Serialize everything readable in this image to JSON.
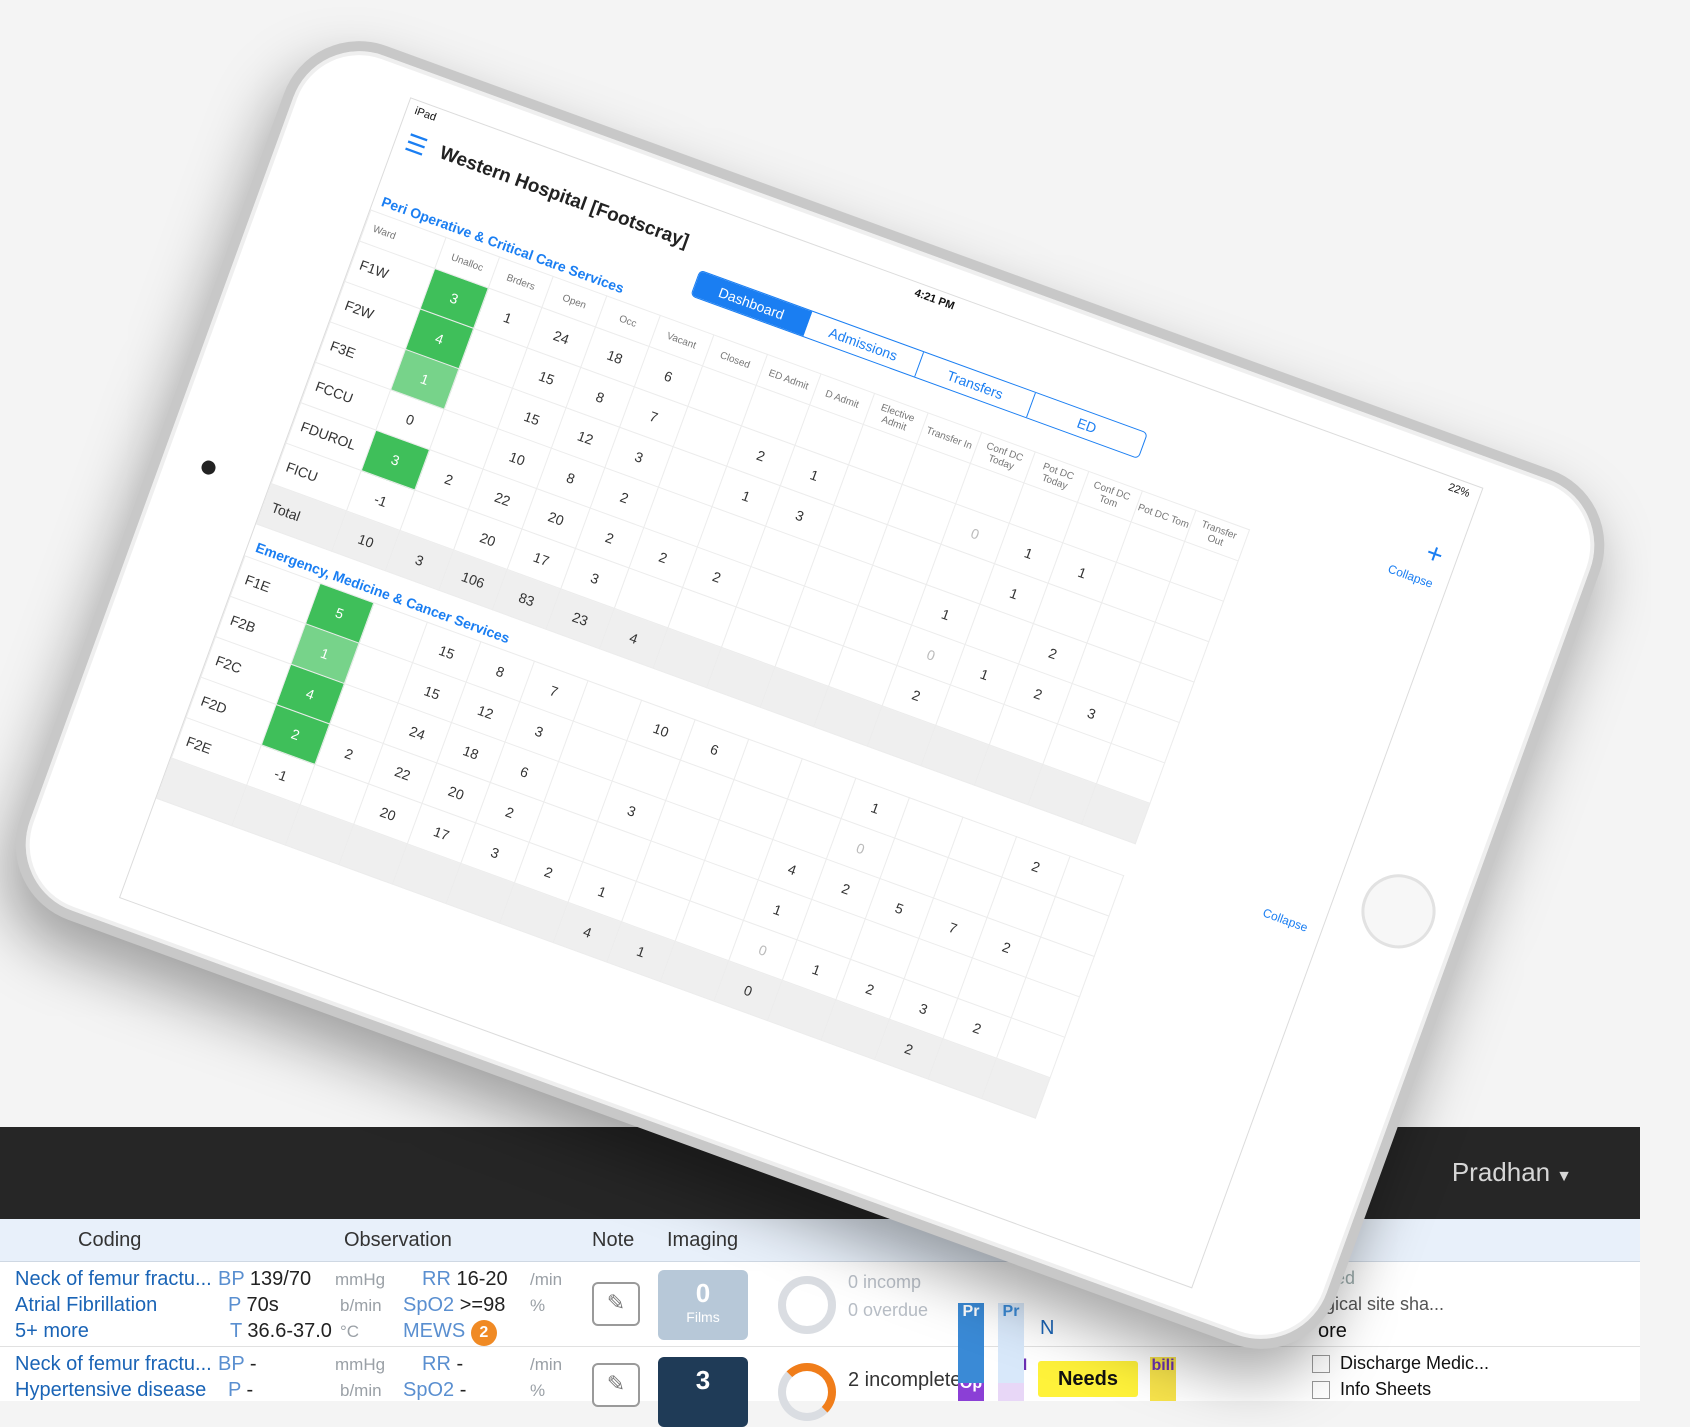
{
  "background_app": {
    "user_name": "Pradhan",
    "headers": [
      "Coding",
      "Observation",
      "Note",
      "Imaging"
    ],
    "rows": [
      {
        "coding": [
          "Neck of femur fractu...",
          "Atrial Fibrillation",
          "5+ more"
        ],
        "obs": {
          "bp_label": "BP",
          "bp": "139/70",
          "bp_unit": "mmHg",
          "p_label": "P",
          "p": "70s",
          "p_unit": "b/min",
          "t_label": "T",
          "t": "36.6-37.0",
          "t_unit": "°C",
          "rr_label": "RR",
          "rr": "16-20",
          "rr_unit": "/min",
          "spo2_label": "SpO2",
          "spo2": ">=98",
          "spo2_unit": "%",
          "mews_label": "MEWS",
          "mews": "2"
        },
        "imaging_count": "0",
        "imaging_label": "Films",
        "tasks": [
          "0 incomp",
          "0 overdue"
        ],
        "right_text": [
          "ed",
          "gical site sha...",
          "ore"
        ]
      },
      {
        "coding": [
          "Neck of femur fractu...",
          "Hypertensive disease"
        ],
        "obs": {
          "bp_label": "BP",
          "bp": "-",
          "bp_unit": "mmHg",
          "p_label": "P",
          "p": "-",
          "p_unit": "b/min",
          "rr_label": "RR",
          "rr": "-",
          "rr_unit": "/min",
          "spo2_label": "SpO2",
          "spo2": "-",
          "spo2_unit": "%"
        },
        "imaging_count": "3",
        "tasks": [
          "2 incomplete"
        ],
        "status_badge": "Needs",
        "checklist": [
          "Discharge Medic...",
          "Info Sheets"
        ]
      }
    ],
    "tags": [
      "Pr",
      "Pr",
      "t-Op",
      "und",
      "N",
      "bili"
    ]
  },
  "ipad": {
    "status_left": "iPad",
    "time": "4:21 PM",
    "battery": "22%",
    "hospital": "Western Hospital [Footscray]",
    "tabs": [
      "Dashboard",
      "Admissions",
      "Transfers",
      "ED"
    ],
    "active_tab": "Dashboard",
    "collapse_label": "Collapse",
    "columns": [
      "Ward",
      "Unalloc",
      "Brders",
      "Open",
      "Occ",
      "Vacant",
      "Closed",
      "ED Admit",
      "D Admit",
      "Elective Admit",
      "Transfer In",
      "Conf DC Today",
      "Pot DC Today",
      "Conf DC Tom",
      "Pot DC Tom",
      "Transfer Out"
    ],
    "sections": [
      {
        "title": "Peri Operative & Critical Care Services",
        "rows": [
          {
            "ward": "F1W",
            "cells": [
              "3",
              "1",
              "24",
              "18",
              "6",
              "",
              "",
              "",
              "",
              "",
              "",
              "",
              "",
              "",
              ""
            ]
          },
          {
            "ward": "F2W",
            "cells": [
              "4",
              "",
              "15",
              "8",
              "7",
              "",
              "2",
              "1",
              "",
              "",
              "0",
              "1",
              "1",
              "",
              ""
            ]
          },
          {
            "ward": "F3E",
            "cells": [
              "1",
              "",
              "15",
              "12",
              "3",
              "",
              "1",
              "3",
              "",
              "",
              "",
              "1",
              "",
              "",
              ""
            ]
          },
          {
            "ward": "FCCU",
            "cells": [
              "0",
              "",
              "10",
              "8",
              "2",
              "",
              "",
              "",
              "",
              "",
              "1",
              "",
              "2",
              "",
              ""
            ]
          },
          {
            "ward": "FDUROL",
            "cells": [
              "3",
              "2",
              "22",
              "20",
              "2",
              "2",
              "2",
              "",
              "",
              "",
              "0",
              "1",
              "2",
              "3",
              ""
            ]
          },
          {
            "ward": "FICU",
            "cells": [
              "-1",
              "",
              "20",
              "17",
              "3",
              "",
              "",
              "",
              "",
              "",
              "2",
              "",
              "",
              "",
              ""
            ]
          }
        ],
        "total": [
          "10",
          "3",
          "106",
          "83",
          "23",
          "4",
          "",
          "",
          "",
          "",
          "",
          "",
          "",
          "",
          ""
        ]
      },
      {
        "title": "Emergency, Medicine & Cancer Services",
        "rows": [
          {
            "ward": "F1E",
            "cells": [
              "5",
              "",
              "15",
              "8",
              "7",
              "",
              "10",
              "6",
              "",
              "",
              "1",
              "",
              "",
              "2",
              ""
            ]
          },
          {
            "ward": "F2B",
            "cells": [
              "1",
              "",
              "15",
              "12",
              "3",
              "",
              "",
              "",
              "",
              "",
              "0",
              "",
              "",
              "",
              ""
            ]
          },
          {
            "ward": "F2C",
            "cells": [
              "4",
              "",
              "24",
              "18",
              "6",
              "",
              "3",
              "",
              "",
              "4",
              "2",
              "5",
              "7",
              "2",
              ""
            ]
          },
          {
            "ward": "F2D",
            "cells": [
              "2",
              "2",
              "22",
              "20",
              "2",
              "",
              "",
              "",
              "",
              "1",
              "",
              "",
              "",
              "",
              ""
            ]
          },
          {
            "ward": "F2E",
            "cells": [
              "-1",
              "",
              "20",
              "17",
              "3",
              "2",
              "1",
              "",
              "",
              "0",
              "1",
              "2",
              "3",
              "2",
              ""
            ]
          }
        ],
        "total": [
          "",
          "",
          "",
          "",
          "",
          "",
          "4",
          "1",
          "",
          "0",
          "",
          "",
          "2",
          "",
          ""
        ]
      }
    ]
  }
}
